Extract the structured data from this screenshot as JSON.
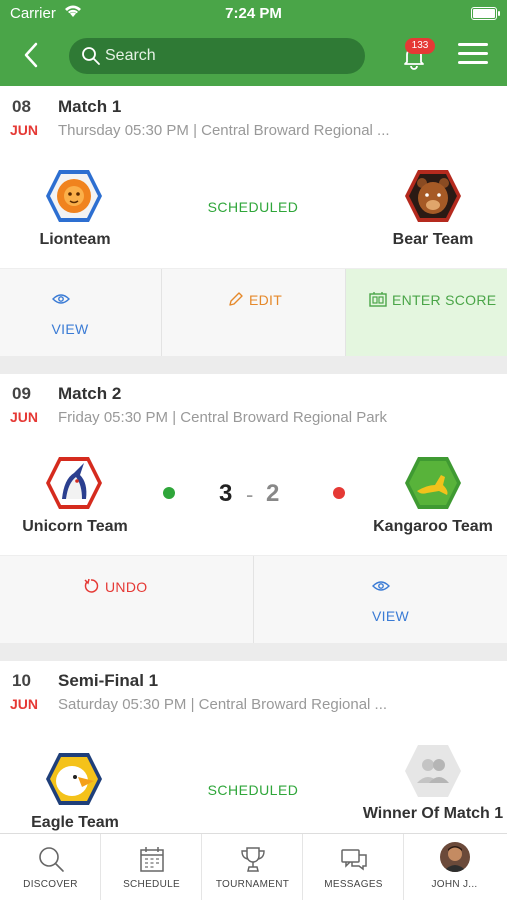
{
  "status_bar": {
    "carrier": "Carrier",
    "time": "7:24 PM"
  },
  "header": {
    "search_placeholder": "Search",
    "notification_count": "133"
  },
  "colors": {
    "brand_green": "#4aa548",
    "dark_green": "#2f7a35",
    "accent_red": "#e53935",
    "status_green": "#2fa63a",
    "link_blue": "#3a7bd5",
    "edit_orange": "#e5892b"
  },
  "matches": [
    {
      "day": "08",
      "month": "JUN",
      "title": "Match 1",
      "subtitle": "Thursday 05:30 PM | Central Broward Regional ...",
      "home": "Lionteam",
      "away": "Bear Team",
      "status": "SCHEDULED",
      "actions": {
        "view": "VIEW",
        "edit": "EDIT",
        "enter_score": "ENTER SCORE"
      }
    },
    {
      "day": "09",
      "month": "JUN",
      "title": "Match 2",
      "subtitle": "Friday 05:30 PM | Central Broward Regional Park",
      "home": "Unicorn Team",
      "away": "Kangaroo Team",
      "home_score": "3",
      "score_sep": "-",
      "away_score": "2",
      "actions": {
        "undo": "UNDO",
        "view": "VIEW"
      }
    },
    {
      "day": "10",
      "month": "JUN",
      "title": "Semi-Final 1",
      "subtitle": "Saturday 05:30 PM | Central Broward Regional ...",
      "home": "Eagle Team",
      "away": "Winner Of Match 1",
      "status": "SCHEDULED"
    }
  ],
  "tabbar": [
    {
      "label": "DISCOVER",
      "icon": "search-icon"
    },
    {
      "label": "SCHEDULE",
      "icon": "calendar-icon"
    },
    {
      "label": "TOURNAMENT",
      "icon": "trophy-icon"
    },
    {
      "label": "MESSAGES",
      "icon": "chat-icon"
    },
    {
      "label": "JOHN J...",
      "icon": "avatar"
    }
  ]
}
